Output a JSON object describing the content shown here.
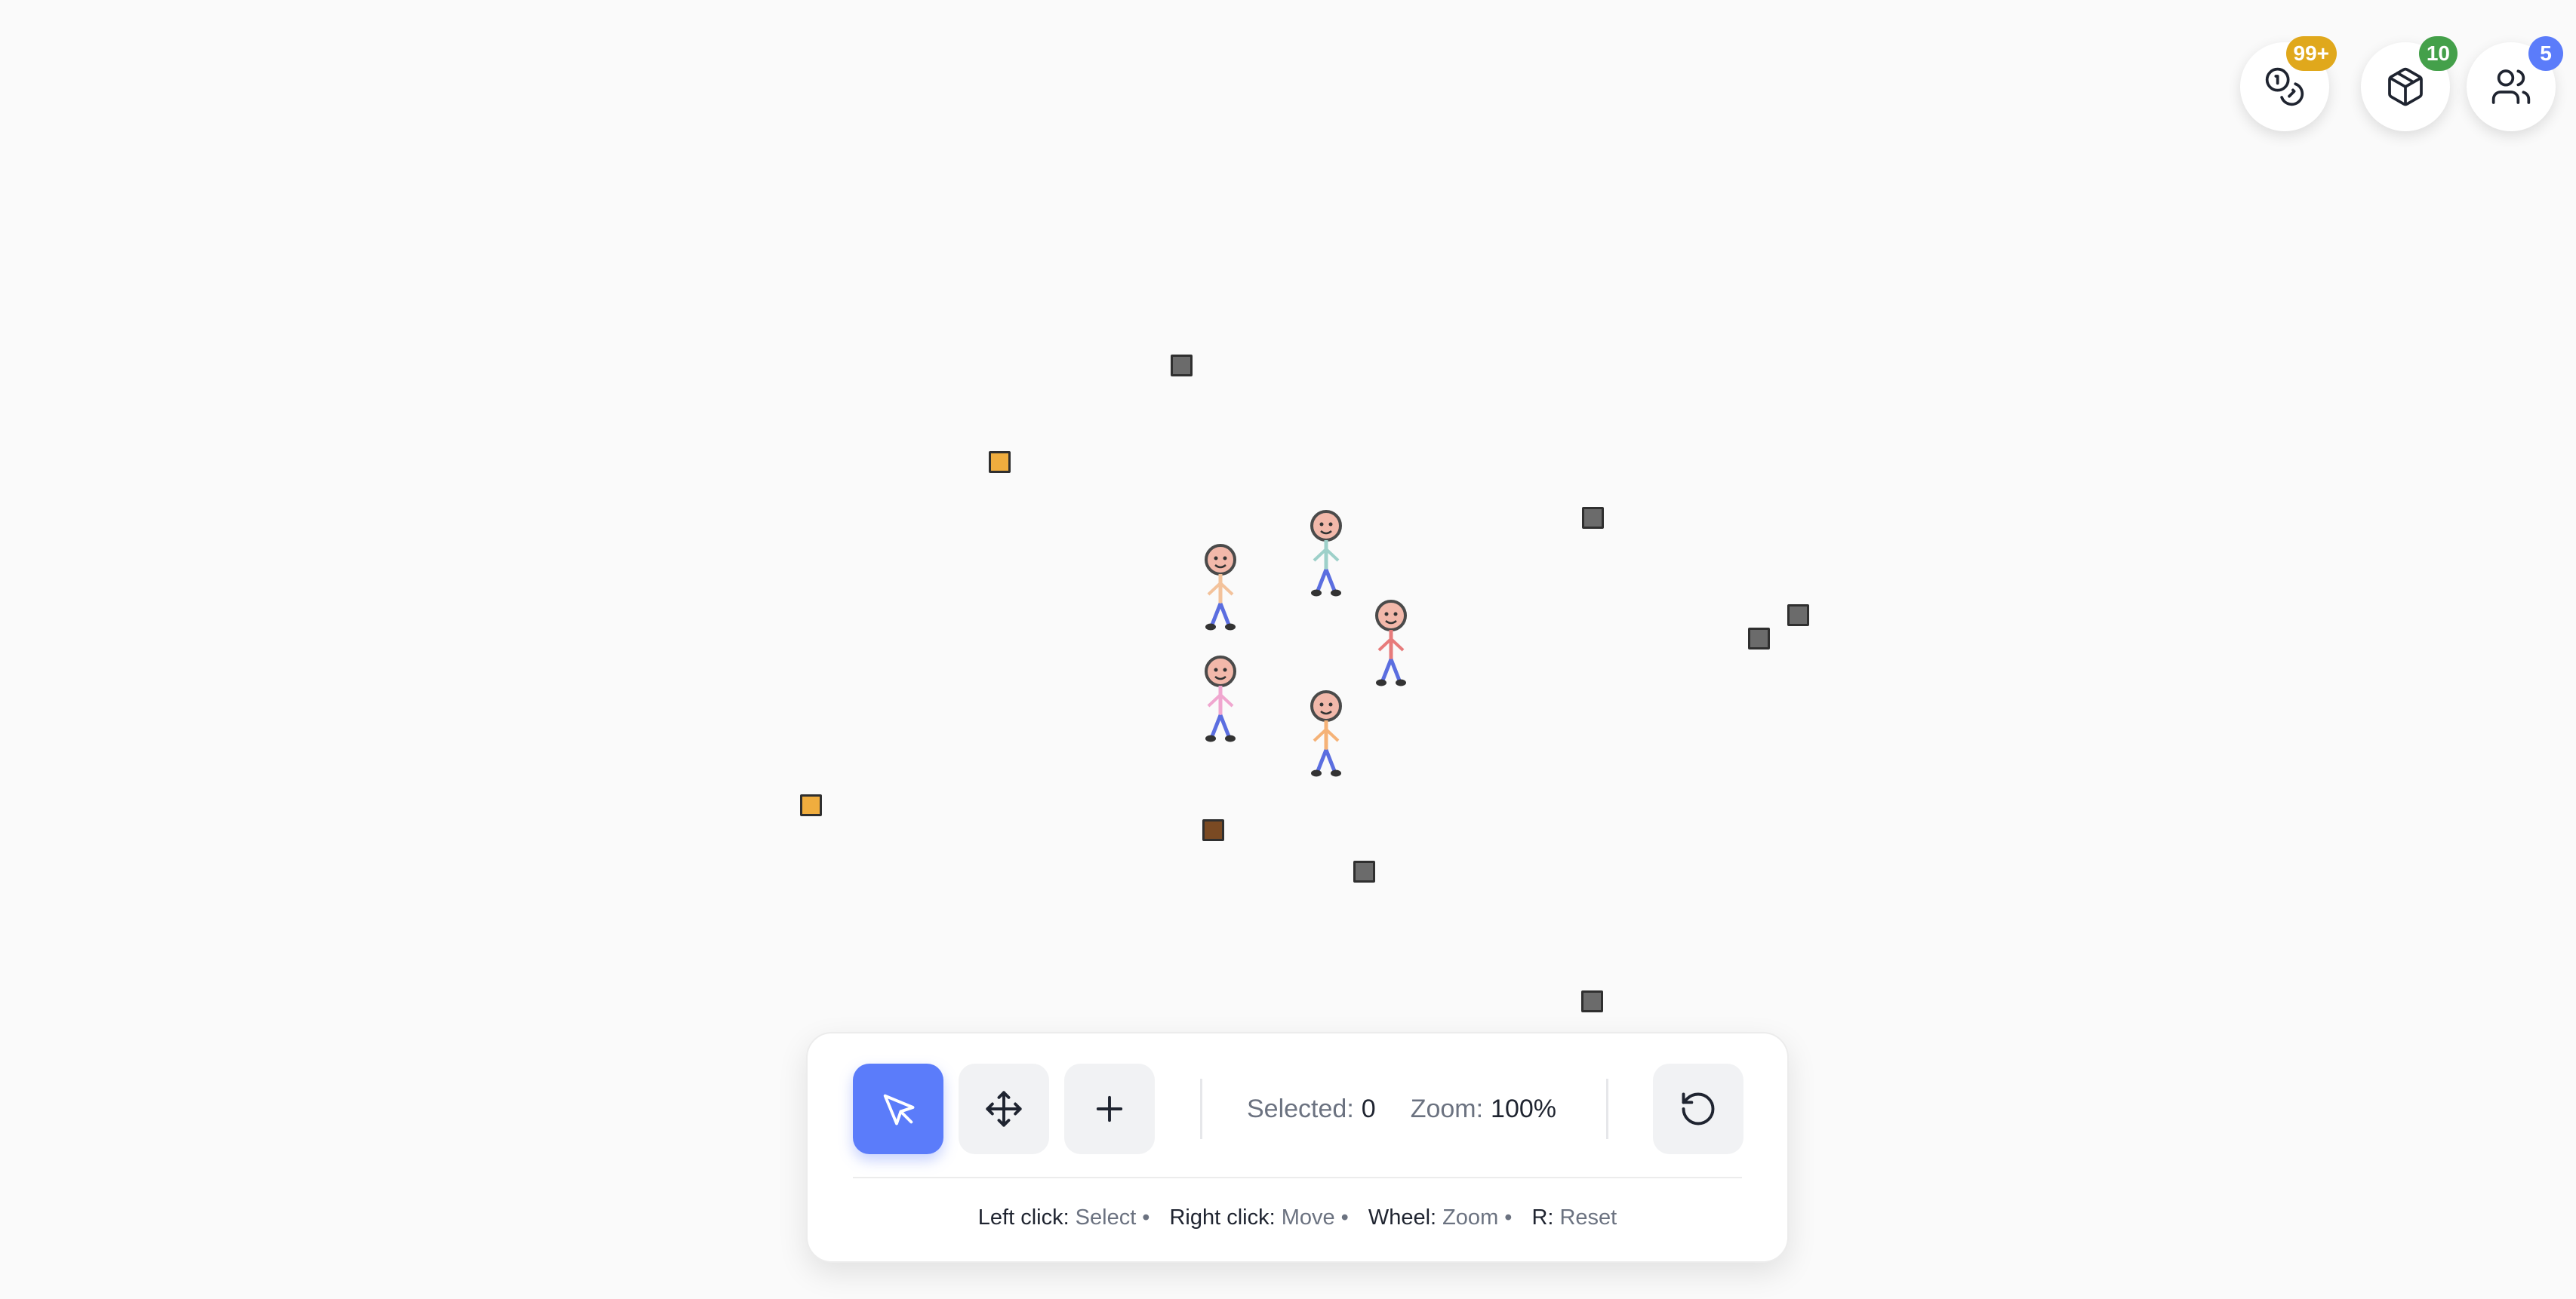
{
  "badges": {
    "resources": {
      "count": "99+",
      "color": "#e0a81c",
      "icon": "coins-icon"
    },
    "items": {
      "count": "10",
      "color": "#44a04a",
      "icon": "box-icon"
    },
    "people": {
      "count": "5",
      "color": "#5b7cfa",
      "icon": "users-icon"
    }
  },
  "toolbar": {
    "tools": [
      {
        "icon": "cursor-icon",
        "active": true
      },
      {
        "icon": "move-icon",
        "active": false
      },
      {
        "icon": "plus-icon",
        "active": false
      }
    ],
    "selected_label": "Selected:",
    "selected_value": "0",
    "zoom_label": "Zoom:",
    "zoom_value": "100%",
    "reset_icon": "reset-icon"
  },
  "hints": [
    {
      "key": "Left click:",
      "action": "Select"
    },
    {
      "key": "Right click:",
      "action": "Move"
    },
    {
      "key": "Wheel:",
      "action": "Zoom"
    },
    {
      "key": "R:",
      "action": "Reset"
    }
  ],
  "colors": {
    "background": "#fafafa",
    "accent": "#5b7cfa",
    "stone": "#6b6b6b",
    "gold": "#f0ad3e",
    "wood": "#7a4a23"
  }
}
